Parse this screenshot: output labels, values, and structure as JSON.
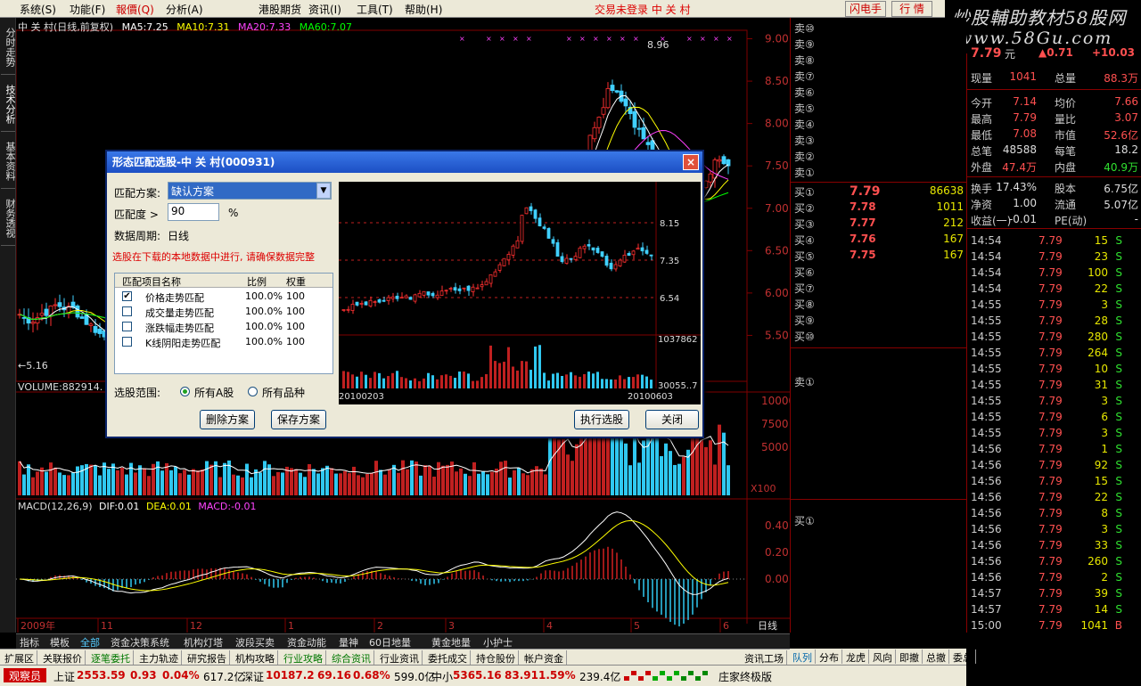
{
  "menu": {
    "items": [
      "系统(S)",
      "功能(F)",
      "報價(Q)",
      "分析(A)",
      "港股期货",
      "资讯(I)",
      "工具(T)",
      "帮助(H)"
    ],
    "status": "交易未登录  中 关 村",
    "btn_flash": "闪电手",
    "btn_quote": "行 情",
    "minimize": "_",
    "maximize": "□",
    "close": "×"
  },
  "brand": {
    "line1": "炒股輔助教材58股网",
    "line2": "www.58Gu.com"
  },
  "vtabs": [
    "分时走势",
    "技术分析",
    "基本资料",
    "财务透视"
  ],
  "chart": {
    "header": {
      "title": "中 关 村(日线,前复权)",
      "ma5": "MA5:7.25",
      "ma10": "MA10:7.31",
      "ma20": "MA20:7.33",
      "ma60": "MA60:7.07"
    },
    "price_labels": [
      "9.00",
      "8.50",
      "8.00",
      "7.50",
      "7.00",
      "6.50",
      "6.00",
      "5.50"
    ],
    "high_marker": "8.96",
    "low_marker": "←5.16",
    "volume_header": "VOLUME:882914.",
    "volume_labels": [
      "10000",
      "7500",
      "5000"
    ],
    "volume_unit": "X100",
    "macd_header": {
      "name": "MACD(12,26,9)",
      "dif": "DIF:0.01",
      "dea": "DEA:0.01",
      "macd": "MACD:-0.01"
    },
    "macd_labels": [
      "0.40",
      "0.20",
      "0.00"
    ],
    "time_labels": [
      "2009年",
      "11",
      "12",
      "1",
      "2",
      "3",
      "4",
      "5",
      "6"
    ],
    "period": "日线",
    "colors": {
      "up": "#ff3030",
      "down": "#40d0ff",
      "ma5": "#ffffff",
      "ma10": "#ffff00",
      "ma20": "#ff40ff",
      "ma60": "#00ff00"
    }
  },
  "bottom_tabs": [
    "指标",
    "模板",
    "全部",
    "资金决策系统",
    "机构灯塔",
    "波段买卖",
    "资金动能",
    "量神",
    "60日地量",
    "黄金地量",
    "小护士"
  ],
  "func_bar": [
    "扩展区",
    "关联报价",
    "逐笔委托",
    "主力轨迹",
    "研究报告",
    "机构攻略",
    "行业攻略",
    "综合资讯",
    "行业资讯",
    "委托成交",
    "持仓股份",
    "帐户资金"
  ],
  "right_func": [
    "资讯工场",
    "队列",
    "分布",
    "龙虎",
    "风向",
    "即撤",
    "总撤",
    "委总"
  ],
  "statusbar": {
    "sh_label": "上证",
    "sh_value": "2553.59",
    "sh_change": "0.93",
    "sh_pct": "0.04%",
    "sh_amount": "617.2亿",
    "sz_label": "深证",
    "sz_value": "10187.2",
    "sz_change": "69.16",
    "sz_pct": "0.68%",
    "sz_amount": "599.0亿",
    "zx_label": "中小",
    "zx_value": "5365.16",
    "zx_change": "83.91",
    "zx_pct": "1.59%",
    "zx_amount": "239.4亿",
    "member": "观察员",
    "edition": "庄家终极版"
  },
  "orderbook": {
    "sells": [
      "卖⑩",
      "卖⑨",
      "卖⑧",
      "卖⑦",
      "卖⑥",
      "卖⑤",
      "卖④",
      "卖③",
      "卖②",
      "卖①"
    ],
    "buys": [
      {
        "label": "买①",
        "price": "7.79",
        "volume": "86638"
      },
      {
        "label": "买②",
        "price": "7.78",
        "volume": "1011"
      },
      {
        "label": "买③",
        "price": "7.77",
        "volume": "212"
      },
      {
        "label": "买④",
        "price": "7.76",
        "volume": "167"
      },
      {
        "label": "买⑤",
        "price": "7.75",
        "volume": "167"
      },
      {
        "label": "买⑥",
        "price": "",
        "volume": ""
      },
      {
        "label": "买⑦",
        "price": "",
        "volume": ""
      },
      {
        "label": "买⑧",
        "price": "",
        "volume": ""
      },
      {
        "label": "买⑨",
        "price": "",
        "volume": ""
      },
      {
        "label": "买⑩",
        "price": "",
        "volume": ""
      }
    ],
    "sell1_label": "卖①",
    "buy1_label": "买①"
  },
  "quote": {
    "price": "7.79",
    "unit": "元",
    "change": "▲0.71",
    "pct": "+10.03",
    "rows": [
      [
        "现量",
        "1041",
        "总量",
        "88.3万"
      ],
      [
        "今开",
        "7.14",
        "均价",
        "7.66"
      ],
      [
        "最高",
        "7.79",
        "量比",
        "3.07"
      ],
      [
        "最低",
        "7.08",
        "市值",
        "52.6亿"
      ],
      [
        "总笔",
        "48588",
        "每笔",
        "18.2"
      ],
      [
        "外盘",
        "47.4万",
        "内盘",
        "40.9万"
      ],
      [
        "换手",
        "17.43%",
        "股本",
        "6.75亿"
      ],
      [
        "净资",
        "1.00",
        "流通",
        "5.07亿"
      ],
      [
        "收益(一)",
        "-0.01",
        "PE(动)",
        "-"
      ]
    ],
    "ticks": [
      [
        "14:54",
        "7.79",
        "15",
        "S"
      ],
      [
        "14:54",
        "7.79",
        "23",
        "S"
      ],
      [
        "14:54",
        "7.79",
        "100",
        "S"
      ],
      [
        "14:54",
        "7.79",
        "22",
        "S"
      ],
      [
        "14:55",
        "7.79",
        "3",
        "S"
      ],
      [
        "14:55",
        "7.79",
        "28",
        "S"
      ],
      [
        "14:55",
        "7.79",
        "280",
        "S"
      ],
      [
        "14:55",
        "7.79",
        "264",
        "S"
      ],
      [
        "14:55",
        "7.79",
        "10",
        "S"
      ],
      [
        "14:55",
        "7.79",
        "31",
        "S"
      ],
      [
        "14:55",
        "7.79",
        "3",
        "S"
      ],
      [
        "14:55",
        "7.79",
        "6",
        "S"
      ],
      [
        "14:55",
        "7.79",
        "3",
        "S"
      ],
      [
        "14:56",
        "7.79",
        "1",
        "S"
      ],
      [
        "14:56",
        "7.79",
        "92",
        "S"
      ],
      [
        "14:56",
        "7.79",
        "15",
        "S"
      ],
      [
        "14:56",
        "7.79",
        "22",
        "S"
      ],
      [
        "14:56",
        "7.79",
        "8",
        "S"
      ],
      [
        "14:56",
        "7.79",
        "3",
        "S"
      ],
      [
        "14:56",
        "7.79",
        "33",
        "S"
      ],
      [
        "14:56",
        "7.79",
        "260",
        "S"
      ],
      [
        "14:56",
        "7.79",
        "2",
        "S"
      ],
      [
        "14:57",
        "7.79",
        "39",
        "S"
      ],
      [
        "14:57",
        "7.79",
        "14",
        "S"
      ],
      [
        "15:00",
        "7.79",
        "1041",
        "B"
      ]
    ]
  },
  "dialog": {
    "title": "形态匹配选股-中 关 村(000931)",
    "close": "×",
    "scheme_label": "匹配方案:",
    "scheme_value": "缺认方案",
    "degree_label": "匹配度 >",
    "degree_value": "90",
    "degree_unit": "%",
    "period_label": "数据周期:",
    "period_value": "日线",
    "warning": "选股在下载的本地数据中进行, 请确保数据完整",
    "table_headers": [
      "匹配项目名称",
      "比例",
      "权重"
    ],
    "table_rows": [
      {
        "checked": "✔",
        "name": "价格走势匹配",
        "ratio": "100.0%",
        "weight": "100"
      },
      {
        "checked": "",
        "name": "成交量走势匹配",
        "ratio": "100.0%",
        "weight": "100"
      },
      {
        "checked": "",
        "name": "涨跌幅走势匹配",
        "ratio": "100.0%",
        "weight": "100"
      },
      {
        "checked": "",
        "name": "K线阴阳走势匹配",
        "ratio": "100.0%",
        "weight": "100"
      }
    ],
    "range_label": "选股范围:",
    "range_a": "所有A股",
    "range_all": "所有品种",
    "btn_delete": "删除方案",
    "btn_save": "保存方案",
    "btn_run": "执行选股",
    "btn_close": "关闭",
    "mini_labels": [
      "8.15",
      "7.35",
      "6.54"
    ],
    "mini_vol_top": "1037862",
    "mini_vol_bottom": "30055..7",
    "mini_date_start": "20100203",
    "mini_date_end": "20100603"
  }
}
